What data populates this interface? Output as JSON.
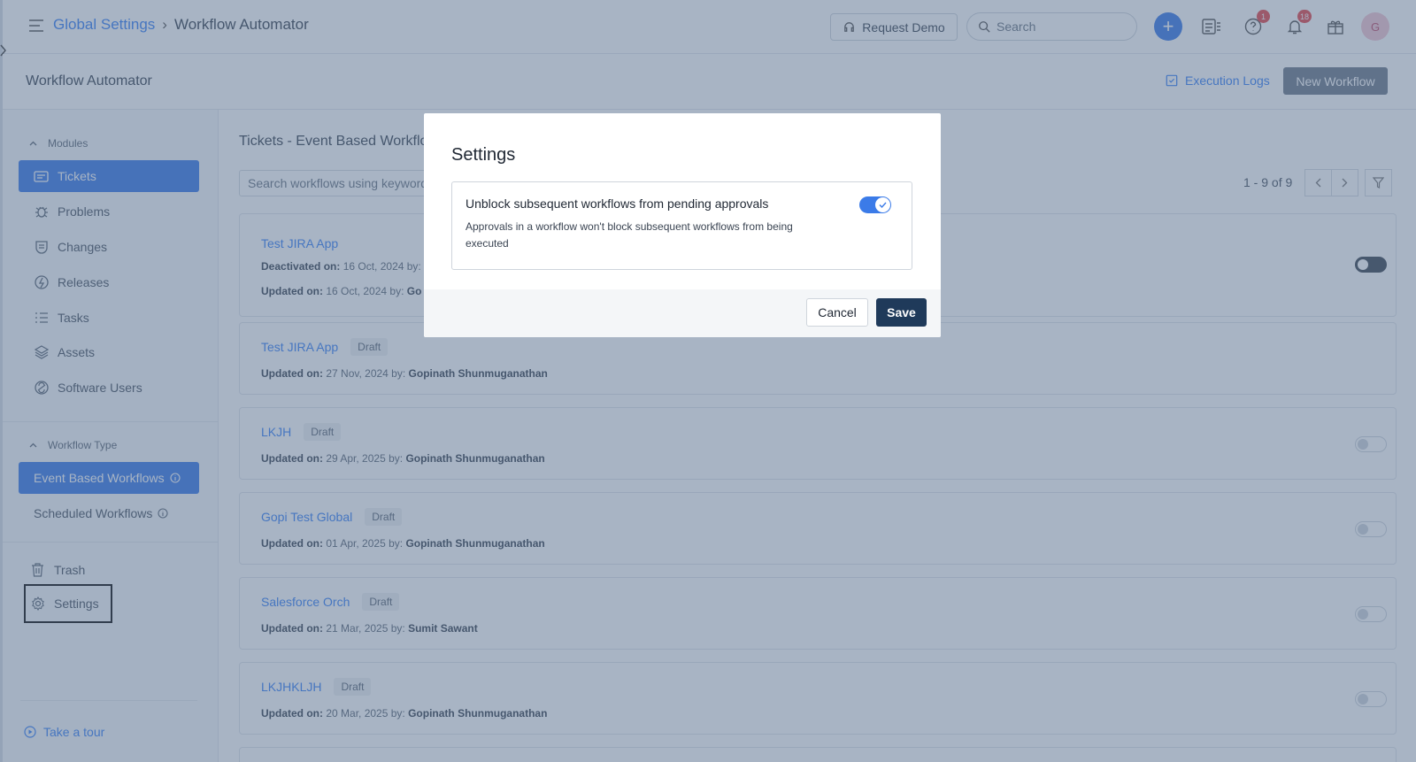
{
  "topbar": {
    "breadcrumb_root": "Global Settings",
    "breadcrumb_sep": "›",
    "breadcrumb_current": "Workflow Automator",
    "request_demo": "Request Demo",
    "search_placeholder": "Search",
    "help_badge": "1",
    "notif_badge": "18",
    "avatar_initial": "G"
  },
  "subheader": {
    "title": "Workflow Automator",
    "execution_logs": "Execution Logs",
    "new_workflow": "New Workflow"
  },
  "sidebar": {
    "modules_header": "Modules",
    "modules": [
      {
        "label": "Tickets",
        "icon": "ticket-icon"
      },
      {
        "label": "Problems",
        "icon": "bug-icon"
      },
      {
        "label": "Changes",
        "icon": "change-icon"
      },
      {
        "label": "Releases",
        "icon": "release-icon"
      },
      {
        "label": "Tasks",
        "icon": "tasks-icon"
      },
      {
        "label": "Assets",
        "icon": "layers-icon"
      },
      {
        "label": "Software Users",
        "icon": "software-icon"
      }
    ],
    "workflow_type_header": "Workflow Type",
    "workflow_types": [
      {
        "label": "Event Based Workflows"
      },
      {
        "label": "Scheduled Workflows"
      }
    ],
    "trash": "Trash",
    "settings": "Settings",
    "take_tour": "Take a tour"
  },
  "main": {
    "section_title": "Tickets - Event Based Workflows",
    "search_placeholder": "Search workflows using keywords",
    "pager_text": "1 - 9 of 9",
    "workflows": [
      {
        "title": "Test JIRA App",
        "status": "",
        "meta1_label": "Deactivated on:",
        "meta1_value": "16 Oct, 2024 by:",
        "meta2_label": "Updated on:",
        "meta2_value": "16 Oct, 2024 by:",
        "meta2_user": "Go"
      },
      {
        "title": "Test JIRA App",
        "status": "Draft",
        "meta_label": "Updated on:",
        "meta_value": "27 Nov, 2024 by:",
        "meta_user": "Gopinath Shunmuganathan"
      },
      {
        "title": "LKJH",
        "status": "Draft",
        "meta_label": "Updated on:",
        "meta_value": "29 Apr, 2025 by:",
        "meta_user": "Gopinath Shunmuganathan"
      },
      {
        "title": "Gopi Test Global",
        "status": "Draft",
        "meta_label": "Updated on:",
        "meta_value": "01 Apr, 2025 by:",
        "meta_user": "Gopinath Shunmuganathan"
      },
      {
        "title": "Salesforce Orch",
        "status": "Draft",
        "meta_label": "Updated on:",
        "meta_value": "21 Mar, 2025 by:",
        "meta_user": "Sumit Sawant"
      },
      {
        "title": "LKJHKLJH",
        "status": "Draft",
        "meta_label": "Updated on:",
        "meta_value": "20 Mar, 2025 by:",
        "meta_user": "Gopinath Shunmuganathan"
      }
    ]
  },
  "modal": {
    "title": "Settings",
    "option_label": "Unblock subsequent workflows from pending approvals",
    "option_desc": "Approvals in a workflow won't block subsequent workflows from being executed",
    "option_enabled": true,
    "cancel": "Cancel",
    "save": "Save"
  },
  "colors": {
    "accent": "#3b7be8",
    "save_button": "#1f3a5a",
    "overlay": "#526a8a"
  }
}
